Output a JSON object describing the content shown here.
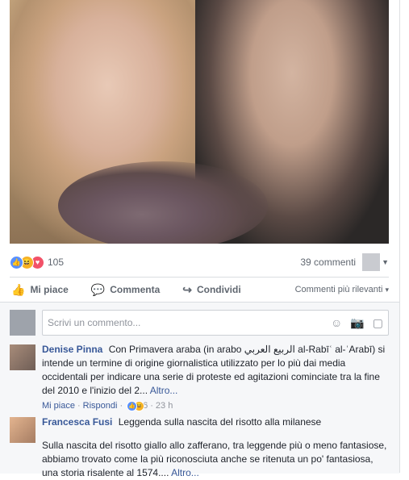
{
  "post": {
    "reactions": {
      "count": "105",
      "types": [
        "like",
        "haha",
        "love"
      ]
    },
    "comments_count": "39 commenti"
  },
  "actions": {
    "like": "Mi piace",
    "comment": "Commenta",
    "share": "Condividi",
    "sort": "Commenti più rilevanti"
  },
  "composer": {
    "placeholder": "Scrivi un commento..."
  },
  "comments": [
    {
      "author": "Denise Pinna",
      "text": "Con Primavera araba (in arabo الربيع العربي al-Rabīʿ al-ʿArabī) si intende un termine di origine giornalistica utilizzato per lo più dai media occidentali per indicare una serie di proteste ed agitazioni cominciate tra la fine del 2010 e l'inizio del 2...",
      "more": "Altro...",
      "meta_like": "Mi piace",
      "meta_reply": "Rispondi",
      "reaction_count": "6",
      "time": "23 h"
    },
    {
      "author": "Francesca Fusi",
      "headline": "Leggenda sulla nascita del risotto alla milanese",
      "text": "Sulla nascita del risotto giallo allo zafferano, tra leggende più o meno fantasiose, abbiamo trovato come la più riconosciuta anche se ritenuta un po' fantasiosa, una storia risalente al 1574....",
      "more": "Altro..."
    }
  ]
}
